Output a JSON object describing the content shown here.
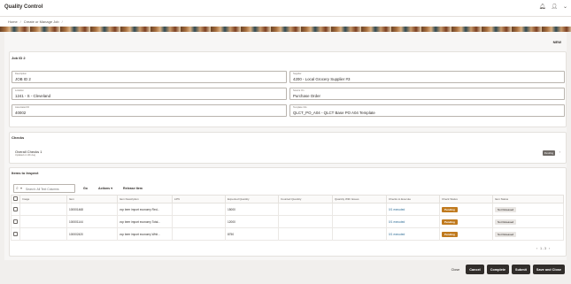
{
  "app": {
    "title": "Quality Control"
  },
  "top_icons": {
    "bell": "bell-icon",
    "user": "user-icon",
    "chevron": "chevron-down-icon"
  },
  "breadcrumb": {
    "items": [
      "Home",
      "Create or Manage Job"
    ]
  },
  "header": {
    "new_badge": "NEW"
  },
  "job": {
    "title": "Job ID 2",
    "fields": {
      "description": {
        "label": "Description",
        "value": "JOB ID 2"
      },
      "supplier": {
        "label": "Supplier",
        "value": "4200 - Local Grocery Supplier #3"
      },
      "location": {
        "label": "Location",
        "value": "1241 - S - Cleveland"
      },
      "source": {
        "label": "Source On",
        "value": "Purchase Order"
      },
      "reference": {
        "label": "Associated ID",
        "value": "40002"
      },
      "template": {
        "label": "Template Info",
        "value": "QLCT_PO_A04 - QLCT Base PO A04 Template"
      }
    }
  },
  "checks": {
    "title": "Checks",
    "items": [
      {
        "name": "Overall Checks 1",
        "sub": "Updated on 4th Aug",
        "status": "Pending"
      }
    ]
  },
  "items": {
    "title": "Items to Inspect",
    "search_placeholder": "Search: All Text Columns",
    "go_label": "Go",
    "actions_label": "Actions",
    "release_label": "Release Item",
    "columns": [
      "",
      "Image",
      "Item",
      "Item Description",
      "LPN",
      "Expected Quantity",
      "Counted Quantity",
      "Quantity With Issues",
      "Checks to Execute",
      "Check Status",
      "Item Status"
    ],
    "rows": [
      {
        "item": "100001468",
        "desc": "vcp beer import economy Red...",
        "lpn": "",
        "expected": "15000",
        "counted": "",
        "issues": "",
        "checks": "0/1 executed",
        "check_status": "Pending",
        "item_status": "Not Released"
      },
      {
        "item": "100001144",
        "desc": "vcp beer import economy Total...",
        "lpn": "",
        "expected": "12000",
        "counted": "",
        "issues": "",
        "checks": "0/1 executed",
        "check_status": "Pending",
        "item_status": "Not Released"
      },
      {
        "item": "100002420",
        "desc": "vcp beer import economy Whit...",
        "lpn": "",
        "expected": "8750",
        "counted": "",
        "issues": "",
        "checks": "0/1 executed",
        "check_status": "Pending",
        "item_status": "Not Released"
      }
    ],
    "pager": "1 - 3"
  },
  "footer": {
    "close": "Close",
    "cancel": "Cancel",
    "complete": "Complete",
    "submit": "Submit",
    "save_close": "Save and Close"
  },
  "colors": {
    "pending": "#c07a1e",
    "dark_button": "#312d2a",
    "link": "#2c6b94"
  }
}
